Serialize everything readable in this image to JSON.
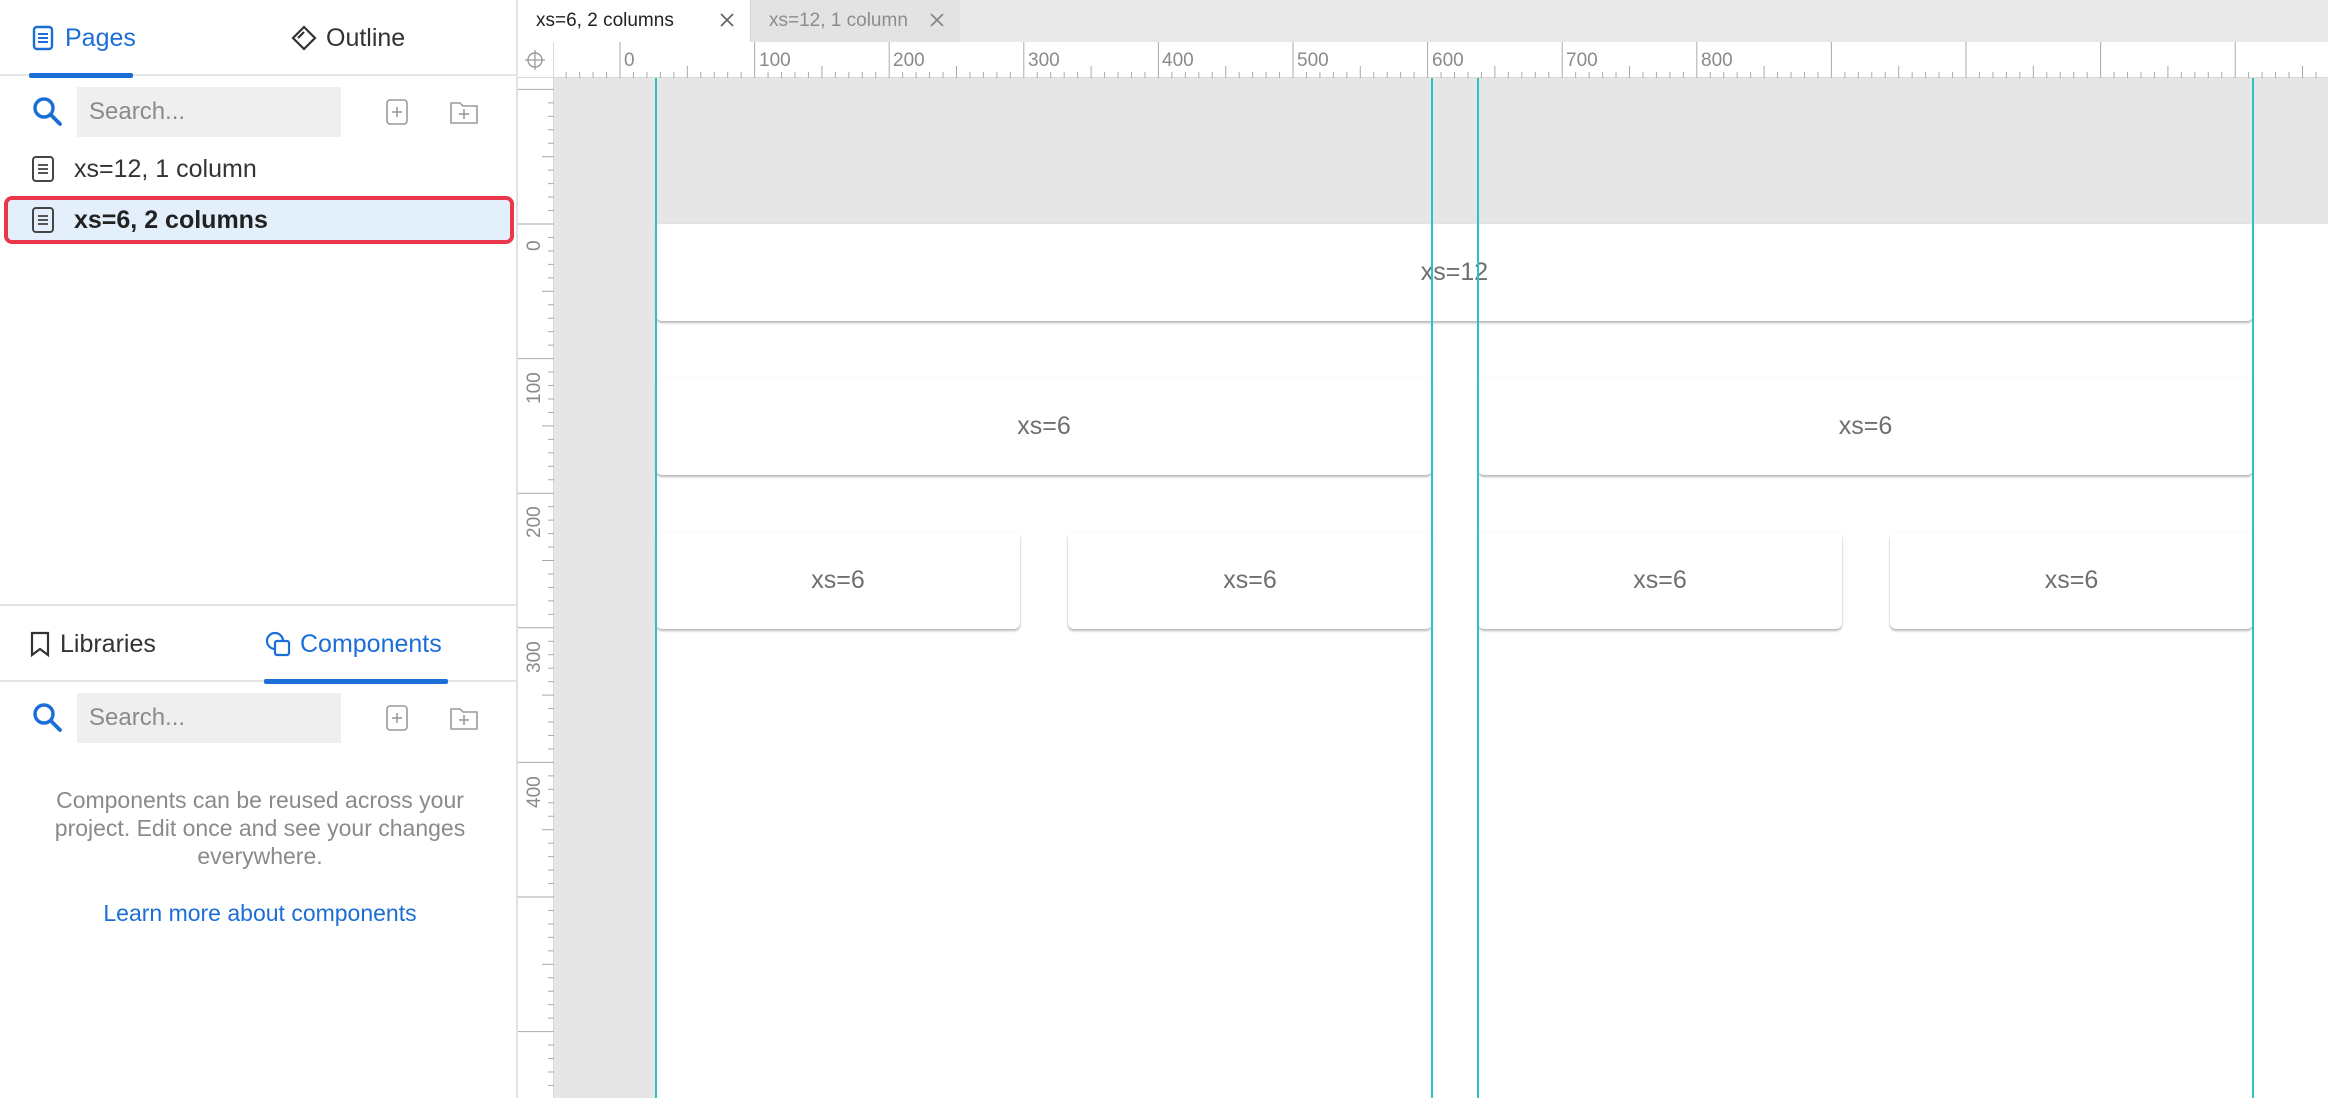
{
  "left_panel": {
    "top_tabs": [
      {
        "label": "Pages",
        "icon": "page-icon",
        "active": true
      },
      {
        "label": "Outline",
        "icon": "outline-diamond-icon",
        "active": false
      }
    ],
    "pages_search": {
      "placeholder": "Search..."
    },
    "pages": [
      {
        "label": "xs=12, 1 column",
        "selected": false
      },
      {
        "label": "xs=6, 2 columns",
        "selected": true
      }
    ],
    "bottom_tabs": [
      {
        "label": "Libraries",
        "icon": "bookmark-icon",
        "active": false
      },
      {
        "label": "Components",
        "icon": "components-icon",
        "active": true
      }
    ],
    "components_search": {
      "placeholder": "Search..."
    },
    "empty_state": {
      "text": "Components can be reused across your project. Edit once and see your changes everywhere.",
      "link": "Learn more about components"
    }
  },
  "editor": {
    "tabs": [
      {
        "label": "xs=6, 2 columns",
        "active": true
      },
      {
        "label": "xs=12, 1 column",
        "active": false
      }
    ],
    "hruler_labels": [
      "0",
      "100",
      "200",
      "300",
      "400",
      "500",
      "600",
      "700",
      "800"
    ],
    "vruler_labels": [
      "0",
      "100",
      "200",
      "300",
      "400"
    ],
    "grid_row1": [
      "xs=12"
    ],
    "grid_row2": [
      "xs=6",
      "xs=6"
    ],
    "grid_row3": [
      "xs=6",
      "xs=6",
      "xs=6",
      "xs=6"
    ]
  },
  "colors": {
    "accent": "#1b6ed6",
    "selection_border": "#e8384a",
    "selection_bg": "#e3f0fb",
    "guide": "#29c5c5"
  }
}
